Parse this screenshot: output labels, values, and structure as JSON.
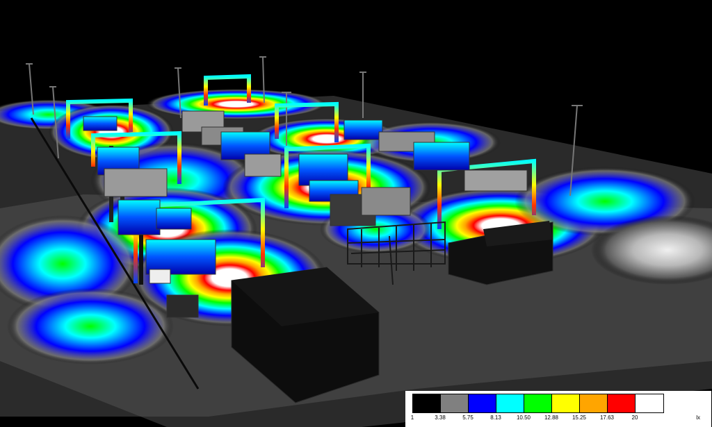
{
  "legend": {
    "unit": "lx",
    "ticks": [
      "1",
      "3.38",
      "5.75",
      "8.13",
      "10.50",
      "12.88",
      "15.25",
      "17.63",
      "20"
    ],
    "colors": [
      "#000000",
      "#808080",
      "#0000ff",
      "#00ffff",
      "#00ff00",
      "#ffff00",
      "#ffa500",
      "#ff0000",
      "#ffffff"
    ]
  }
}
